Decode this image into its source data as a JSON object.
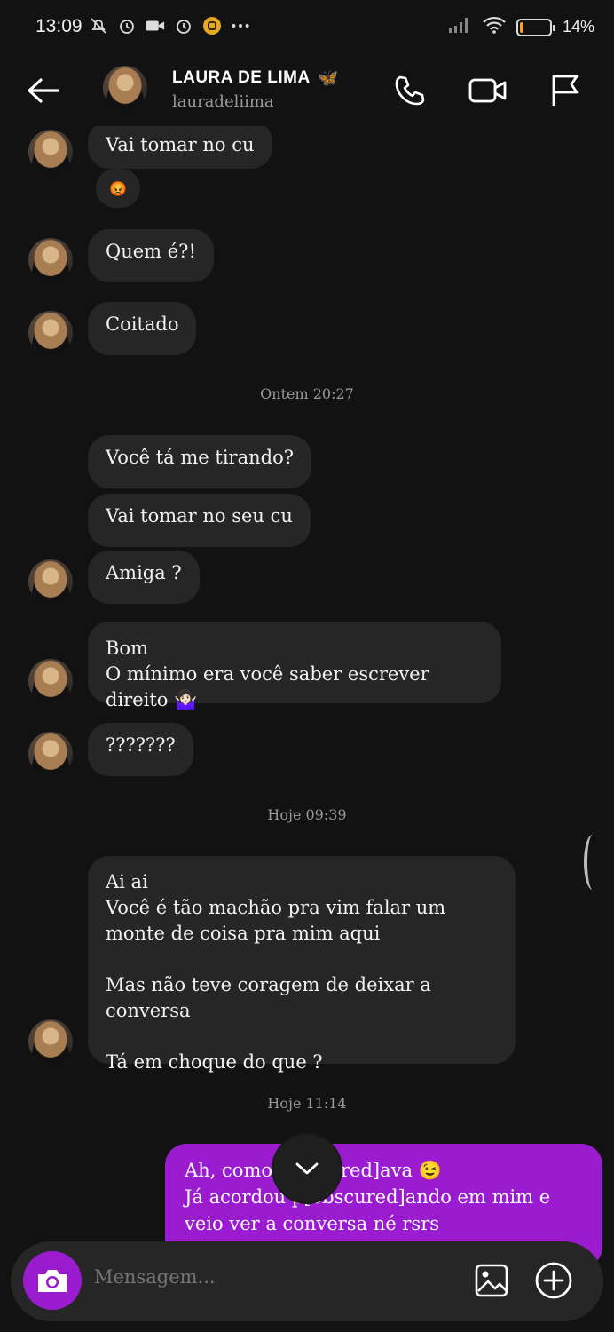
{
  "status_bar": {
    "time": "13:09",
    "battery_text": "14%",
    "battery_level": 0.14,
    "icons": [
      "mute-bell-icon",
      "alarm-icon",
      "video-recording-icon",
      "alarm-icon",
      "app-notification-icon",
      "more-dots-icon",
      "signal-icon",
      "wifi-icon",
      "battery-icon"
    ]
  },
  "header": {
    "name": "LAURA DE LIMA",
    "name_emoji": "🦋",
    "username": "lauradeliima"
  },
  "messages": [
    {
      "text": "Vai tomar no cu",
      "reaction": "😡"
    },
    {
      "text": "Quem é?!"
    },
    {
      "text": "Coitado"
    },
    {
      "timestamp": "Ontem 20:27"
    },
    {
      "text": "Você tá me tirando?"
    },
    {
      "text": "Vai tomar no seu cu"
    },
    {
      "text": "Amiga ?"
    },
    {
      "text": "Bom\nO mínimo era você saber escrever direito 🤷🏻‍♀️"
    },
    {
      "text": "???????"
    },
    {
      "timestamp": "Hoje 09:39"
    },
    {
      "text": "Ai ai\nVocê é tão machão pra vim falar um monte de coisa pra mim aqui\n\nMas não teve coragem de deixar a conversa\n\nTá em choque do que ?"
    },
    {
      "timestamp": "Hoje 11:14"
    }
  ],
  "my_message": {
    "text": "Ah, como [obscured]ava 😉\nJá acordou p[obscured]ando em mim e veio ver a conversa né rsrs"
  },
  "composer": {
    "placeholder": "Mensagem..."
  },
  "colors": {
    "background": "#121212",
    "incoming_bubble": "#262626",
    "outgoing_bubble": "#9b1bd0",
    "accent": "#9b1bd0"
  }
}
